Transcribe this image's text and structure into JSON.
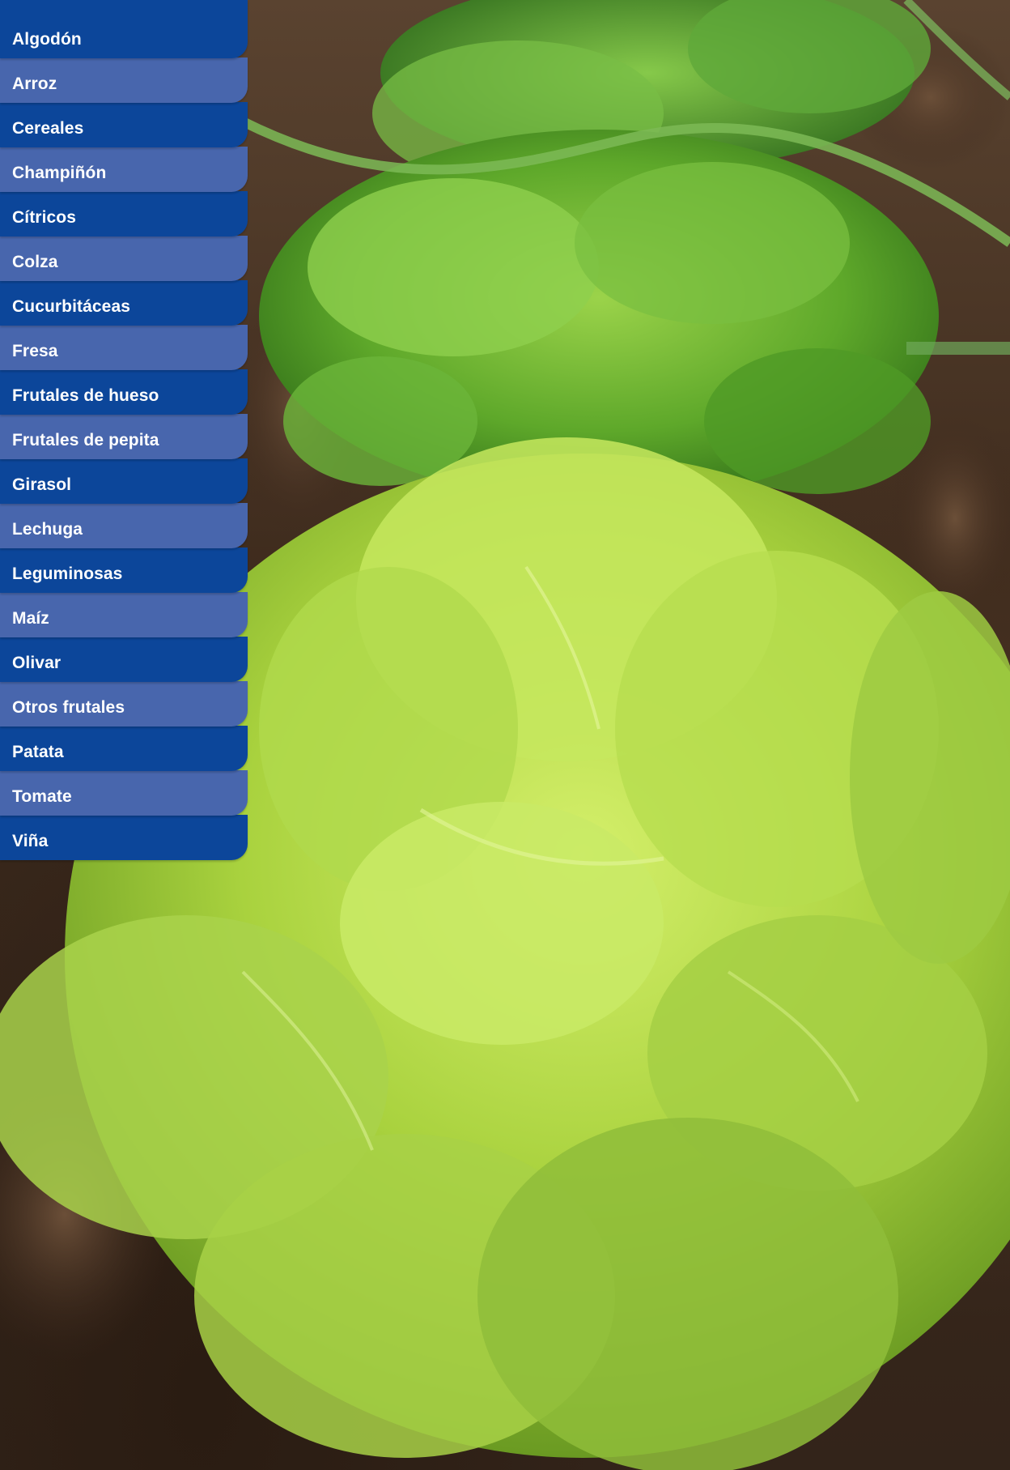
{
  "background_image": {
    "subject": "lettuce-plants-in-soil"
  },
  "colors": {
    "menu_dark": "#0c469a",
    "menu_light": "#4866ad",
    "menu_text": "#ffffff"
  },
  "menu": {
    "items": [
      {
        "label": "Algodón"
      },
      {
        "label": "Arroz"
      },
      {
        "label": "Cereales"
      },
      {
        "label": "Champiñón"
      },
      {
        "label": "Cítricos"
      },
      {
        "label": "Colza"
      },
      {
        "label": "Cucurbitáceas"
      },
      {
        "label": "Fresa"
      },
      {
        "label": "Frutales de hueso"
      },
      {
        "label": "Frutales de pepita"
      },
      {
        "label": "Girasol"
      },
      {
        "label": "Lechuga"
      },
      {
        "label": "Leguminosas"
      },
      {
        "label": "Maíz"
      },
      {
        "label": "Olivar"
      },
      {
        "label": "Otros frutales"
      },
      {
        "label": "Patata"
      },
      {
        "label": "Tomate"
      },
      {
        "label": "Viña"
      }
    ]
  }
}
